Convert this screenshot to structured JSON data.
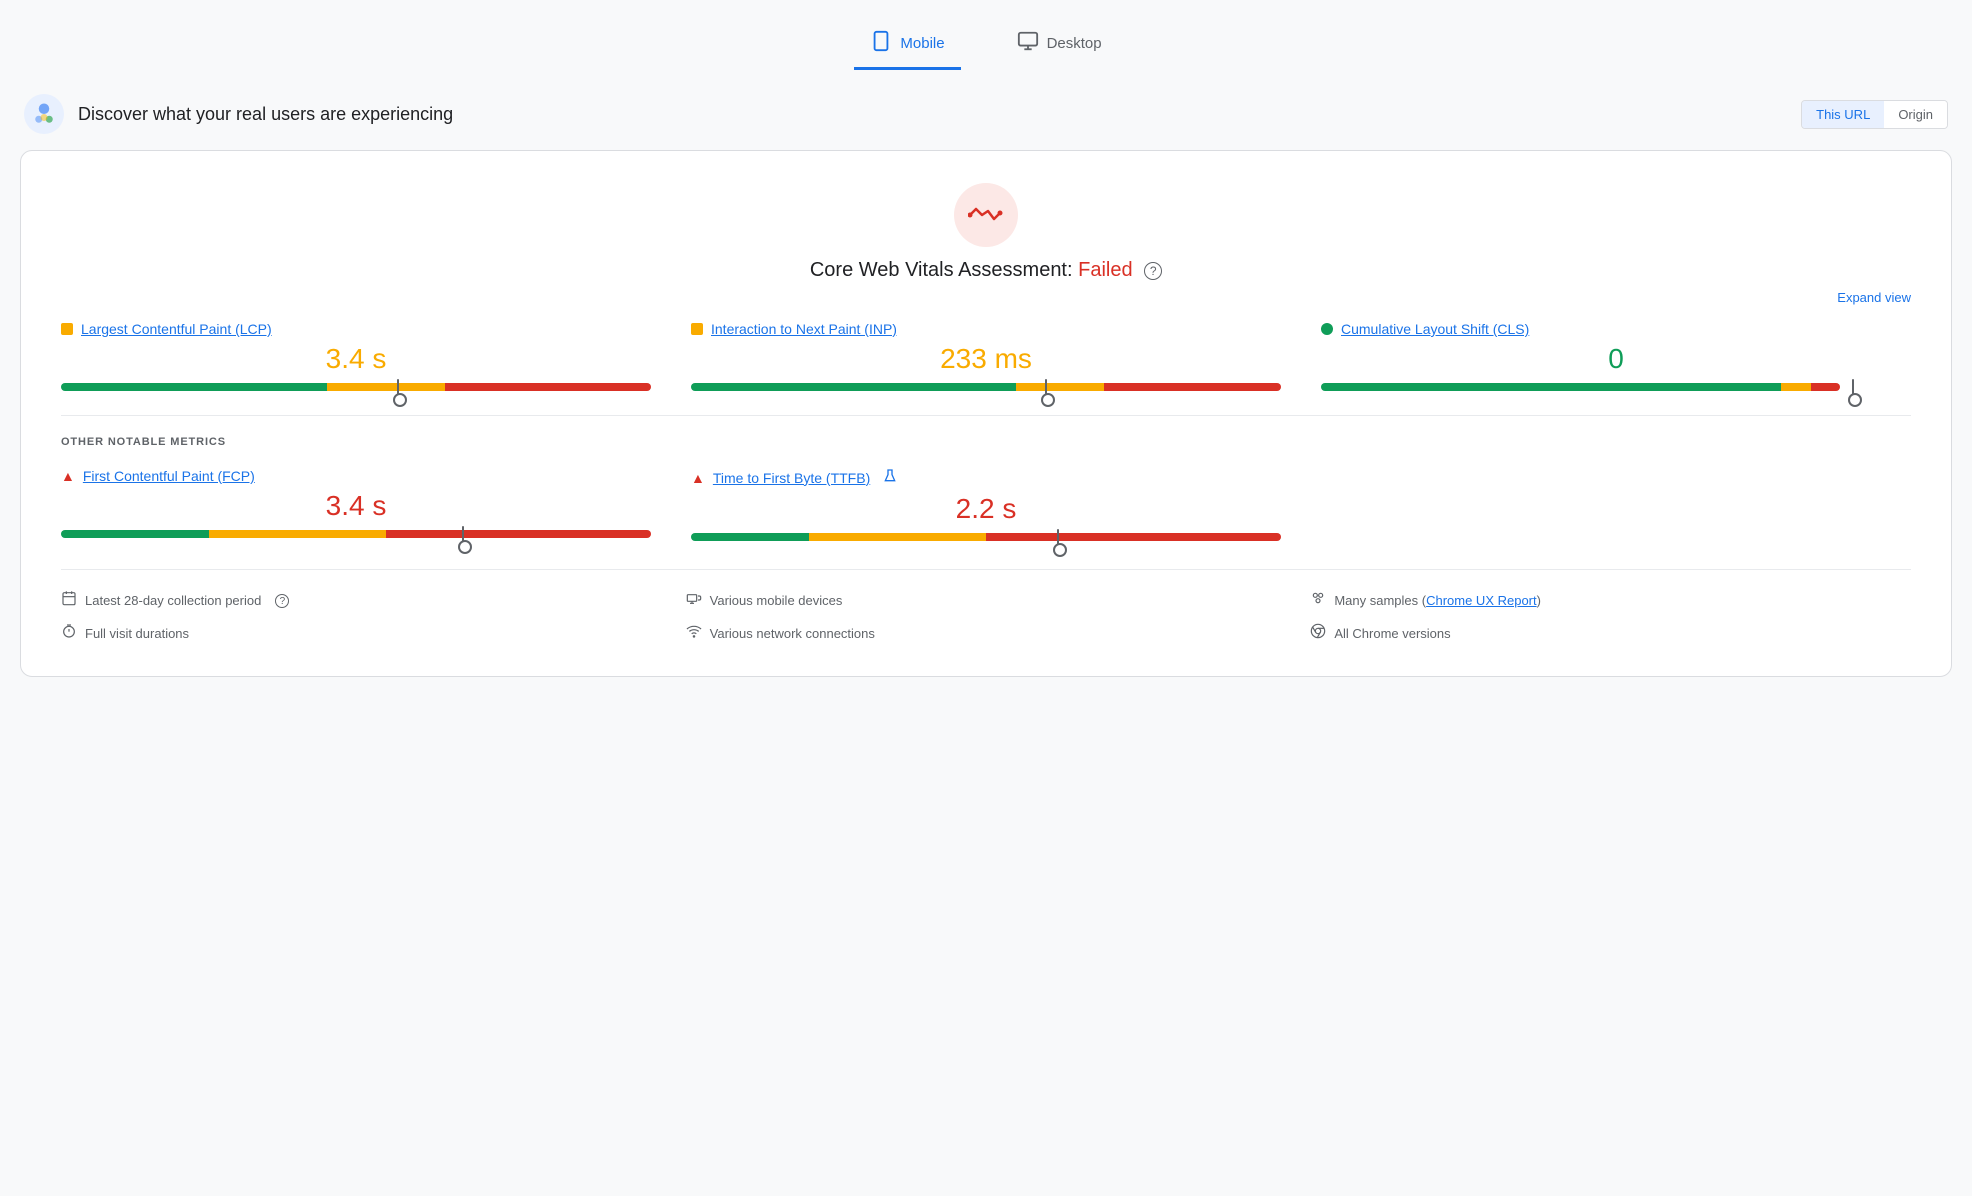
{
  "tabs": [
    {
      "id": "mobile",
      "label": "Mobile",
      "active": true
    },
    {
      "id": "desktop",
      "label": "Desktop",
      "active": false
    }
  ],
  "header": {
    "title": "Discover what your real users are experiencing",
    "url_toggle": {
      "this_url": "This URL",
      "origin": "Origin"
    }
  },
  "cwv": {
    "title_prefix": "Core Web Vitals Assessment: ",
    "status": "Failed",
    "expand_label": "Expand view"
  },
  "metrics": [
    {
      "id": "lcp",
      "name": "Largest Contentful Paint (LCP)",
      "value": "3.4 s",
      "value_color": "orange",
      "dot_type": "orange",
      "bar": {
        "green": 45,
        "orange": 20,
        "red": 35,
        "marker_pct": 57
      }
    },
    {
      "id": "inp",
      "name": "Interaction to Next Paint (INP)",
      "value": "233 ms",
      "value_color": "orange",
      "dot_type": "orange",
      "bar": {
        "green": 55,
        "orange": 15,
        "red": 30,
        "marker_pct": 60
      }
    },
    {
      "id": "cls",
      "name": "Cumulative Layout Shift (CLS)",
      "value": "0",
      "value_color": "green",
      "dot_type": "green",
      "bar": {
        "green": 78,
        "orange": 5,
        "red": 5,
        "marker_pct": 90
      }
    }
  ],
  "other_metrics_label": "OTHER NOTABLE METRICS",
  "other_metrics": [
    {
      "id": "fcp",
      "name": "First Contentful Paint (FCP)",
      "value": "3.4 s",
      "value_color": "red",
      "has_triangle": true,
      "has_beaker": false,
      "bar": {
        "green": 25,
        "orange": 30,
        "red": 45,
        "marker_pct": 68
      }
    },
    {
      "id": "ttfb",
      "name": "Time to First Byte (TTFB)",
      "value": "2.2 s",
      "value_color": "red",
      "has_triangle": true,
      "has_beaker": true,
      "bar": {
        "green": 20,
        "orange": 30,
        "red": 50,
        "marker_pct": 62
      }
    }
  ],
  "footer": [
    {
      "icon": "📅",
      "text": "Latest 28-day collection period",
      "has_help": true,
      "link": null
    },
    {
      "icon": "🖥",
      "text": "Various mobile devices",
      "has_help": false,
      "link": null
    },
    {
      "icon": "👥",
      "text_prefix": "Many samples ",
      "link": "Chrome UX Report",
      "text_suffix": "",
      "has_help": false
    },
    {
      "icon": "⏱",
      "text": "Full visit durations",
      "has_help": false,
      "link": null
    },
    {
      "icon": "📶",
      "text": "Various network connections",
      "has_help": false,
      "link": null
    },
    {
      "icon": "🛡",
      "text": "All Chrome versions",
      "has_help": false,
      "link": null
    }
  ]
}
